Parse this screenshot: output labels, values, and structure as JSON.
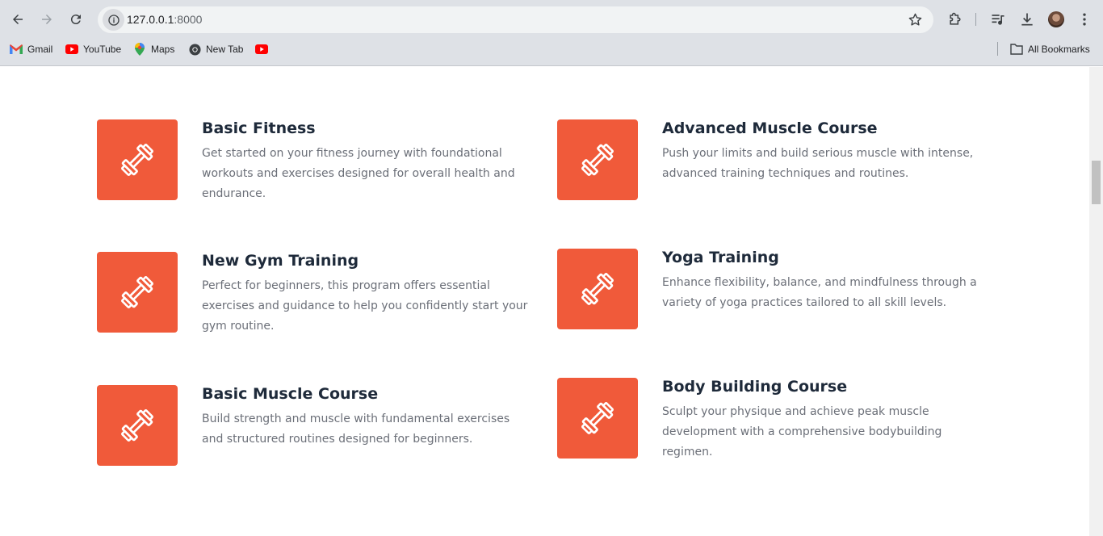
{
  "browser": {
    "url_host": "127.0.0.1",
    "url_port": ":8000",
    "bookmarks": [
      {
        "label": "Gmail",
        "icon": "gmail-icon"
      },
      {
        "label": "YouTube",
        "icon": "youtube-icon"
      },
      {
        "label": "Maps",
        "icon": "maps-icon"
      },
      {
        "label": "New Tab",
        "icon": "chrome-icon"
      },
      {
        "label": "",
        "icon": "youtube-icon"
      }
    ],
    "all_bookmarks": "All Bookmarks"
  },
  "theme": {
    "accent": "#f05a3a",
    "heading": "#1e2a3a",
    "text": "#6b6f78"
  },
  "courses": [
    {
      "title": "Basic Fitness",
      "description": "Get started on your fitness journey with foundational workouts and exercises designed for overall health and endurance.",
      "icon": "dumbbell-icon"
    },
    {
      "title": "Advanced Muscle Course",
      "description": "Push your limits and build serious muscle with intense, advanced training techniques and routines.",
      "icon": "dumbbell-icon"
    },
    {
      "title": "New Gym Training",
      "description": "Perfect for beginners, this program offers essential exercises and guidance to help you confidently start your gym routine.",
      "icon": "dumbbell-icon"
    },
    {
      "title": "Yoga Training",
      "description": "Enhance flexibility, balance, and mindfulness through a variety of yoga practices tailored to all skill levels.",
      "icon": "dumbbell-icon"
    },
    {
      "title": "Basic Muscle Course",
      "description": "Build strength and muscle with fundamental exercises and structured routines designed for beginners.",
      "icon": "dumbbell-icon"
    },
    {
      "title": "Body Building Course",
      "description": "Sculpt your physique and achieve peak muscle development with a comprehensive bodybuilding regimen.",
      "icon": "dumbbell-icon"
    }
  ]
}
